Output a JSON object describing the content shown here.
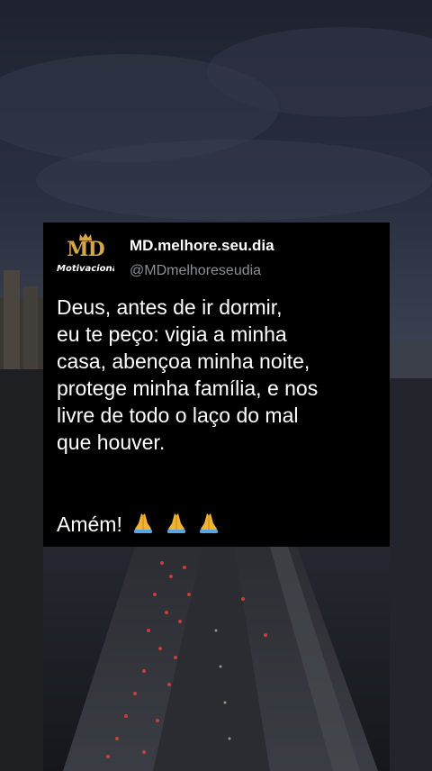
{
  "profile": {
    "logo_text": "MD",
    "logo_subtext": "Motivacional",
    "display_name": "MD.melhore.seu.dia",
    "handle": "@MDmelhoreseudia"
  },
  "post": {
    "lines": [
      "Deus, antes de ir dormir,",
      "eu te peço: vigia a minha",
      "casa, abençoa minha noite,",
      "protege minha família, e nos",
      "livre de todo o laço do mal",
      "que houver."
    ],
    "closing": "Amém!",
    "closing_emoji": [
      "folded-hands-icon",
      "folded-hands-icon",
      "folded-hands-icon"
    ]
  },
  "colors": {
    "card_background": "#000000",
    "logo_gold": "#d4a64a",
    "handle_gray": "#8b8f96",
    "sky": "#2a2f40",
    "city_lights": "#e0413a"
  }
}
